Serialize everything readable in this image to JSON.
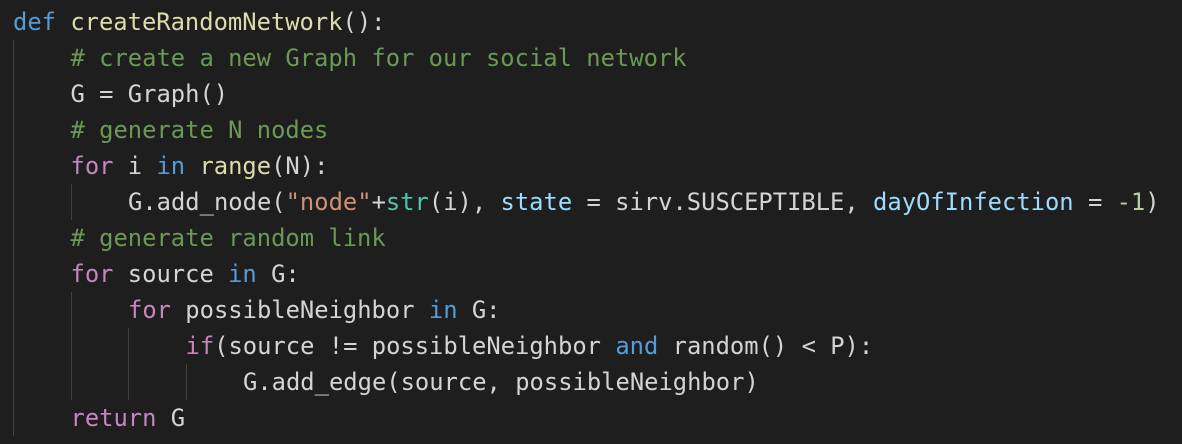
{
  "editor": {
    "background": "#1e1e1e",
    "colors": {
      "keyword": "#569cd6",
      "control": "#c586c0",
      "function": "#dcdcaa",
      "string": "#ce9178",
      "builtin": "#4ec9b0",
      "parameter": "#9cdcfe",
      "comment": "#6a9955",
      "number": "#b5cea8",
      "text": "#d4d4d4"
    },
    "lines": [
      {
        "indent": 0,
        "tokens": [
          {
            "t": "def",
            "c": "kw"
          },
          {
            "t": " ",
            "c": "plain"
          },
          {
            "t": "createRandomNetwork",
            "c": "fn"
          },
          {
            "t": "():",
            "c": "plain"
          }
        ]
      },
      {
        "indent": 1,
        "tokens": [
          {
            "t": "# create a new Graph for our social network",
            "c": "cmt"
          }
        ]
      },
      {
        "indent": 1,
        "tokens": [
          {
            "t": "G = Graph()",
            "c": "plain"
          }
        ]
      },
      {
        "indent": 1,
        "tokens": [
          {
            "t": "# generate N nodes",
            "c": "cmt"
          }
        ]
      },
      {
        "indent": 1,
        "tokens": [
          {
            "t": "for",
            "c": "ctrl"
          },
          {
            "t": " i ",
            "c": "plain"
          },
          {
            "t": "in",
            "c": "kw"
          },
          {
            "t": " ",
            "c": "plain"
          },
          {
            "t": "range",
            "c": "fn"
          },
          {
            "t": "(N):",
            "c": "plain"
          }
        ]
      },
      {
        "indent": 2,
        "tokens": [
          {
            "t": "G.add_node(",
            "c": "plain"
          },
          {
            "t": "\"node\"",
            "c": "str"
          },
          {
            "t": "+",
            "c": "plain"
          },
          {
            "t": "str",
            "c": "cls"
          },
          {
            "t": "(i), ",
            "c": "plain"
          },
          {
            "t": "state",
            "c": "param"
          },
          {
            "t": " = sirv.SUSCEPTIBLE, ",
            "c": "plain"
          },
          {
            "t": "dayOfInfection",
            "c": "param"
          },
          {
            "t": " = ",
            "c": "plain"
          },
          {
            "t": "-1",
            "c": "num"
          },
          {
            "t": ")",
            "c": "plain"
          }
        ]
      },
      {
        "indent": 1,
        "tokens": [
          {
            "t": "# generate random link",
            "c": "cmt"
          }
        ]
      },
      {
        "indent": 1,
        "tokens": [
          {
            "t": "for",
            "c": "ctrl"
          },
          {
            "t": " source ",
            "c": "plain"
          },
          {
            "t": "in",
            "c": "kw"
          },
          {
            "t": " G:",
            "c": "plain"
          }
        ]
      },
      {
        "indent": 2,
        "tokens": [
          {
            "t": "for",
            "c": "ctrl"
          },
          {
            "t": " possibleNeighbor ",
            "c": "plain"
          },
          {
            "t": "in",
            "c": "kw"
          },
          {
            "t": " G:",
            "c": "plain"
          }
        ]
      },
      {
        "indent": 3,
        "tokens": [
          {
            "t": "if",
            "c": "ctrl"
          },
          {
            "t": "(source != possibleNeighbor ",
            "c": "plain"
          },
          {
            "t": "and",
            "c": "kw"
          },
          {
            "t": " random() < P):",
            "c": "plain"
          }
        ]
      },
      {
        "indent": 4,
        "tokens": [
          {
            "t": "G.add_edge(source, possibleNeighbor)",
            "c": "plain"
          }
        ]
      },
      {
        "indent": 1,
        "tokens": [
          {
            "t": "return",
            "c": "ctrl"
          },
          {
            "t": " G",
            "c": "plain"
          }
        ]
      }
    ]
  }
}
